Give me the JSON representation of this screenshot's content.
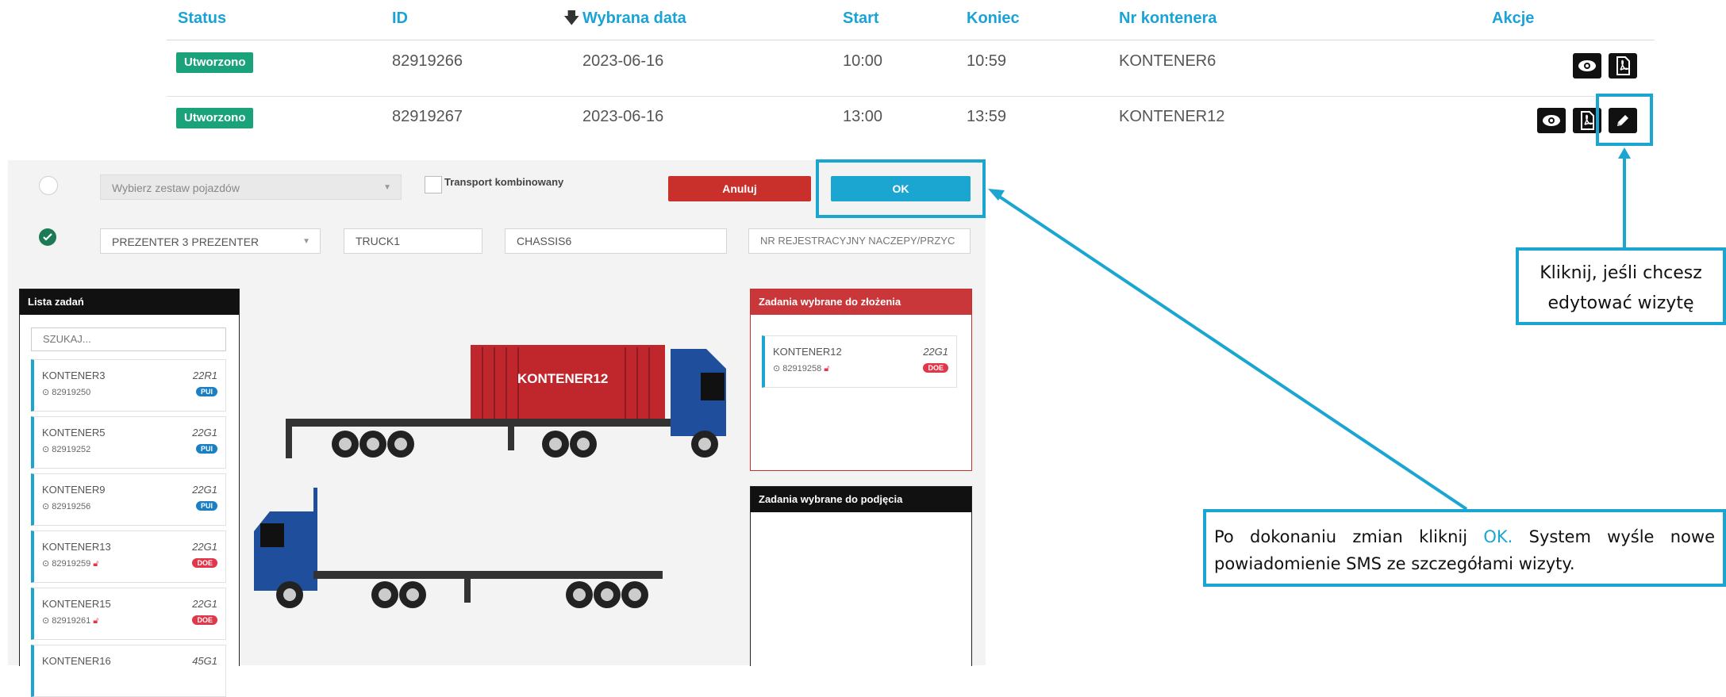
{
  "table": {
    "headers": {
      "status": "Status",
      "id": "ID",
      "date": "Wybrana data",
      "start": "Start",
      "end": "Koniec",
      "container": "Nr kontenera",
      "actions": "Akcje"
    },
    "rows": [
      {
        "status": "Utworzono",
        "id": "82919266",
        "date": "2023-06-16",
        "start": "10:00",
        "end": "10:59",
        "container": "KONTENER6"
      },
      {
        "status": "Utworzono",
        "id": "82919267",
        "date": "2023-06-16",
        "start": "13:00",
        "end": "13:59",
        "container": "KONTENER12"
      }
    ]
  },
  "form": {
    "vehicle_set_placeholder": "Wybierz zestaw pojazdów",
    "combined_transport_label": "Transport kombinowany",
    "cancel_label": "Anuluj",
    "ok_label": "OK",
    "driver_value": "PREZENTER 3 PREZENTER",
    "truck_value": "TRUCK1",
    "chassis_value": "CHASSIS6",
    "trailer_placeholder": "NR REJESTRACYJNY NACZEPY/PRZYC"
  },
  "task_list": {
    "title": "Lista zadań",
    "search_placeholder": "SZUKAJ...",
    "items": [
      {
        "name": "KONTENER3",
        "code": "22R1",
        "id": "82919250",
        "tag": "PUI",
        "lock": false
      },
      {
        "name": "KONTENER5",
        "code": "22G1",
        "id": "82919252",
        "tag": "PUI",
        "lock": false
      },
      {
        "name": "KONTENER9",
        "code": "22G1",
        "id": "82919256",
        "tag": "PUI",
        "lock": false
      },
      {
        "name": "KONTENER13",
        "code": "22G1",
        "id": "82919259",
        "tag": "DOE",
        "lock": true
      },
      {
        "name": "KONTENER15",
        "code": "22G1",
        "id": "82919261",
        "tag": "DOE",
        "lock": true
      },
      {
        "name": "KONTENER16",
        "code": "45G1",
        "id": "",
        "tag": "",
        "lock": false
      }
    ]
  },
  "truck_container_label": "KONTENER12",
  "drop_panel": {
    "title": "Zadania wybrane do złożenia",
    "item": {
      "name": "KONTENER12",
      "code": "22G1",
      "id": "82919258",
      "tag": "DOE"
    }
  },
  "pickup_panel": {
    "title": "Zadania wybrane do podjęcia"
  },
  "callouts": {
    "edit_line1": "Kliknij, jeśli chcesz",
    "edit_line2": "edytować wizytę",
    "ok_text_before": "Po dokonaniu zmian kliknij ",
    "ok_text_ok": "OK.",
    "ok_text_after": " System wyśle nowe powiadomienie SMS ze szczegółami wizyty."
  },
  "colors": {
    "accent": "#1ba6d2",
    "status_green": "#1aa37a",
    "cancel_red": "#c9302c",
    "tag_blue": "#1b7fc4",
    "tag_red": "#e0374b",
    "container_red": "#c0272d",
    "truck_blue": "#1f4f9c"
  }
}
